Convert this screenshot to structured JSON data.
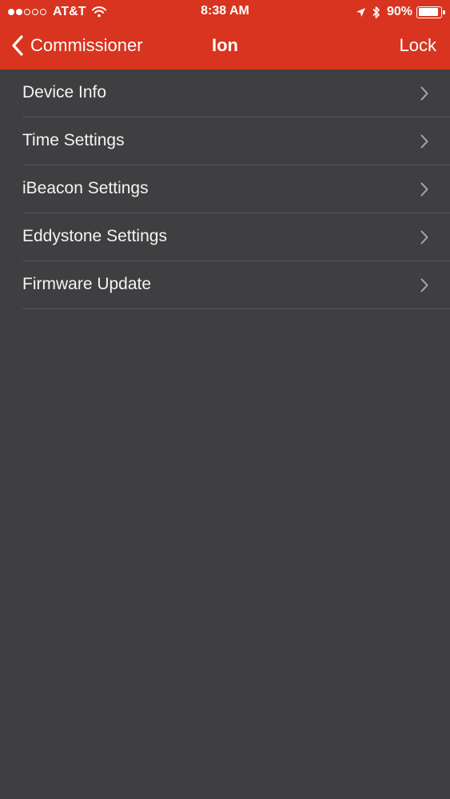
{
  "status_bar": {
    "carrier": "AT&T",
    "time": "8:38 AM",
    "battery_percent": "90%",
    "battery_level": 0.9,
    "signal_filled": 2,
    "signal_total": 5
  },
  "nav": {
    "back_label": "Commissioner",
    "title": "Ion",
    "right_label": "Lock"
  },
  "menu": {
    "items": [
      {
        "label": "Device Info"
      },
      {
        "label": "Time Settings"
      },
      {
        "label": "iBeacon Settings"
      },
      {
        "label": "Eddystone Settings"
      },
      {
        "label": "Firmware Update"
      }
    ]
  },
  "colors": {
    "header": "#d9341f",
    "background": "#3f3e40",
    "separator": "#555457",
    "chevron": "#a9a9ab"
  }
}
